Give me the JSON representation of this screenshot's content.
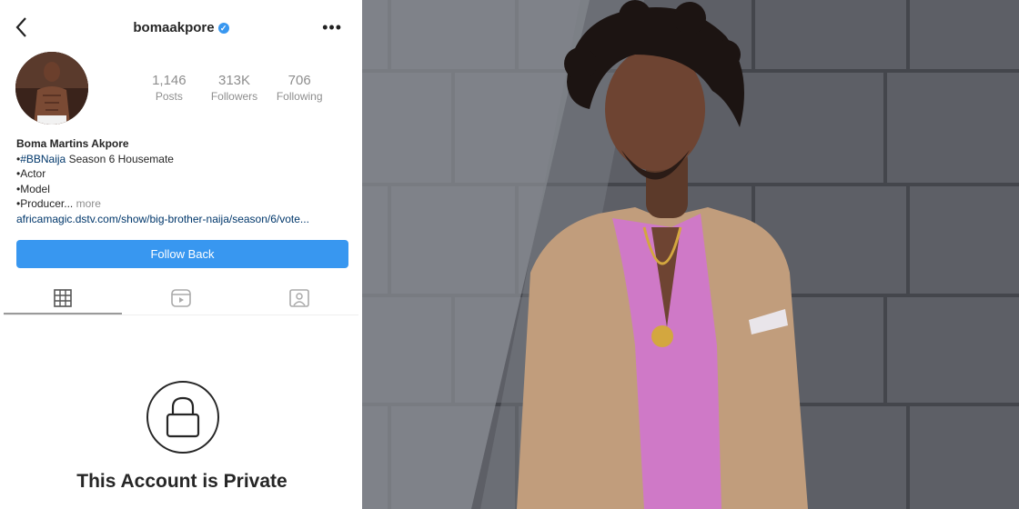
{
  "header": {
    "username": "bomaakpore",
    "verified_icon": "verified-badge-icon",
    "back_icon": "chevron-left-icon",
    "more_icon": "ellipsis-icon"
  },
  "stats": [
    {
      "value": "1,146",
      "label": "Posts"
    },
    {
      "value": "313K",
      "label": "Followers"
    },
    {
      "value": "706",
      "label": "Following"
    }
  ],
  "bio": {
    "name": "Boma Martins Akpore",
    "line1_bullet": "•",
    "line1_tag": "#BBNaija",
    "line1_rest": " Season 6 Housemate",
    "line2": "•Actor",
    "line3": "•Model",
    "line4": "•Producer...",
    "more": "more",
    "link": "africamagic.dstv.com/show/big-brother-naija/season/6/vote..."
  },
  "follow_button": "Follow Back",
  "tabs": [
    {
      "icon": "grid-icon",
      "active": true
    },
    {
      "icon": "reels-icon",
      "active": false
    },
    {
      "icon": "tagged-icon",
      "active": false
    }
  ],
  "private_message": "This Account is Private",
  "colors": {
    "accent": "#3897f0",
    "link": "#00376b",
    "muted": "#8e8e8e"
  }
}
